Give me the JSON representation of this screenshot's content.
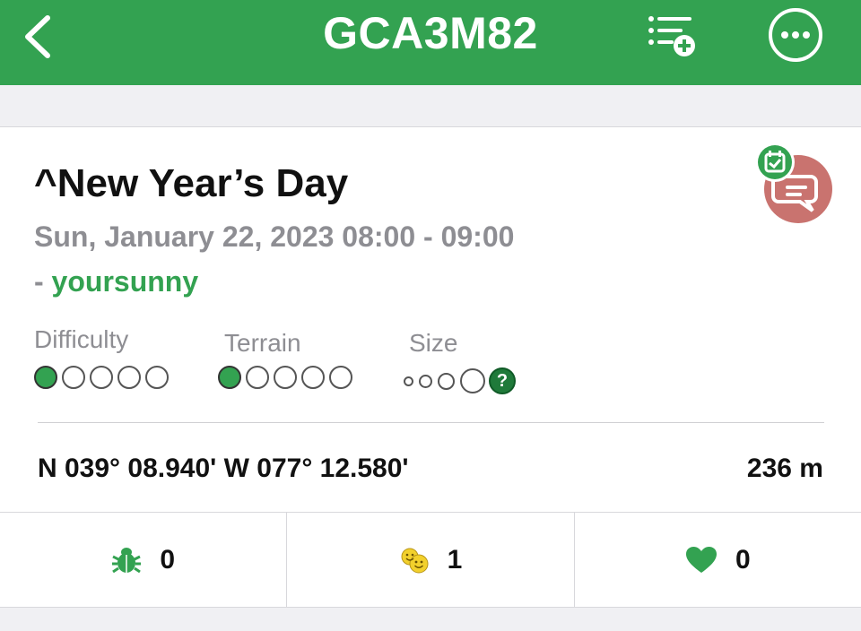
{
  "header": {
    "title": "GCA3M82"
  },
  "cache": {
    "name": "^New Year’s Day",
    "event_date": "Sun, January 22, 2023 08:00 - 09:00",
    "owner_prefix": "- ",
    "owner": "yoursunny",
    "ratings": {
      "difficulty_label": "Difficulty",
      "difficulty_value": 1,
      "terrain_label": "Terrain",
      "terrain_value": 1,
      "size_label": "Size",
      "size_value": "?"
    },
    "coordinates": "N 039° 08.940' W 077° 12.580'",
    "distance": "236 m"
  },
  "stats": {
    "trackables": "0",
    "finds": "1",
    "favorites": "0"
  },
  "colors": {
    "header_green": "#33a251",
    "owner_green": "#33a251",
    "badge_red": "#c9736f"
  }
}
